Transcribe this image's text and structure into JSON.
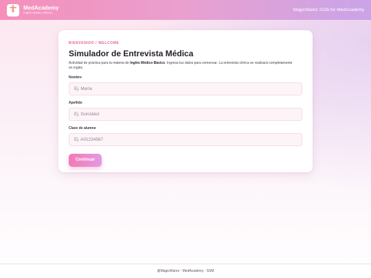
{
  "header": {
    "brand_title": "MedAcademy",
    "brand_subtitle": "Inglés Médico Básico",
    "logo_icon": "caduceus-icon",
    "right_text": "MagicWarez 2026 for MedAcademy"
  },
  "card": {
    "eyebrow": "BIENVENIDO / WELCOME",
    "title": "Simulador de Entrevista Médica",
    "description_prefix": "Actividad de práctica para la materia de ",
    "description_bold": "Inglés Médico Básico",
    "description_suffix": ". Ingresa tus datos para comenzar. La entrevista clínica se realizará completamente en inglés."
  },
  "form": {
    "first_name": {
      "label": "Nombre",
      "placeholder": "Ej. María",
      "value": ""
    },
    "last_name": {
      "label": "Apellido",
      "placeholder": "Ej. González",
      "value": ""
    },
    "student_id": {
      "label": "Clave de alumno",
      "placeholder": "Ej. A01234567",
      "value": ""
    },
    "submit_label": "Continuar"
  },
  "footer": {
    "text": "@MagicWarez - MedAcademy - SSM"
  },
  "colors": {
    "accent": "#e85c9b",
    "header_start": "#f58fba",
    "header_end": "#c9a4e8",
    "button_start": "#f27ab3",
    "button_end": "#e39be0"
  }
}
